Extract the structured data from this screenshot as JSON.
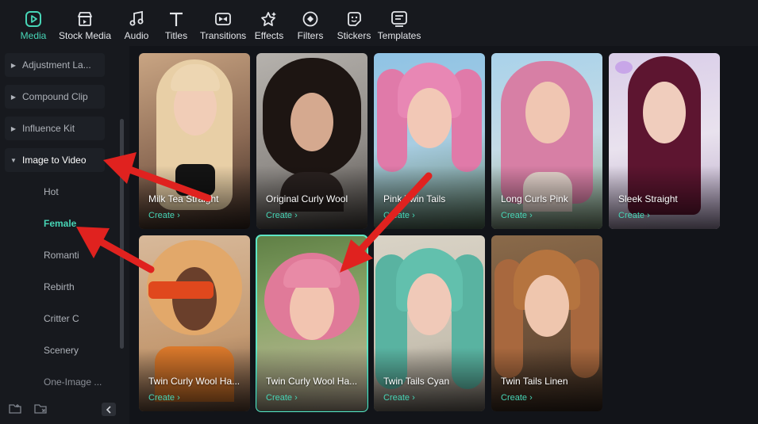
{
  "toolbar": {
    "tabs": [
      {
        "label": "Media",
        "icon": "media-icon",
        "active": true
      },
      {
        "label": "Stock Media",
        "icon": "stock-media-icon"
      },
      {
        "label": "Audio",
        "icon": "music-note-icon"
      },
      {
        "label": "Titles",
        "icon": "text-t-icon"
      },
      {
        "label": "Transitions",
        "icon": "transition-icon"
      },
      {
        "label": "Effects",
        "icon": "effects-star-icon"
      },
      {
        "label": "Filters",
        "icon": "filter-icon"
      },
      {
        "label": "Stickers",
        "icon": "sticker-icon"
      },
      {
        "label": "Templates",
        "icon": "templates-icon"
      }
    ]
  },
  "sidebar": {
    "items": [
      {
        "label": "Adjustment La..."
      },
      {
        "label": "Compound Clip"
      },
      {
        "label": "Influence Kit"
      },
      {
        "label": "Image to Video"
      }
    ],
    "children": [
      {
        "label": "Hot"
      },
      {
        "label": "Female"
      },
      {
        "label": "Romantic"
      },
      {
        "label": "Rebirth"
      },
      {
        "label": "Critter Club"
      },
      {
        "label": "Scenery"
      },
      {
        "label": "One-Image ..."
      }
    ]
  },
  "cards": [
    {
      "title": "Milk Tea Straight",
      "create": "Create ›"
    },
    {
      "title": "Original Curly Wool",
      "create": "Create ›"
    },
    {
      "title": "Pink Twin Tails",
      "create": "Create ›"
    },
    {
      "title": "Long Curls Pink",
      "create": "Create ›"
    },
    {
      "title": "Sleek Straight",
      "create": "Create ›"
    },
    {
      "title": "Twin Curly Wool Ha...",
      "create": "Create ›"
    },
    {
      "title": "Twin Curly Wool Ha...",
      "create": "Create ›"
    },
    {
      "title": "Twin Tails Cyan",
      "create": "Create ›"
    },
    {
      "title": "Twin Tails Linen",
      "create": "Create ›"
    }
  ],
  "colors": {
    "accent": "#47d5b6",
    "annotation_arrow": "#e0221f",
    "selected_outline": "#5ee6c5"
  }
}
